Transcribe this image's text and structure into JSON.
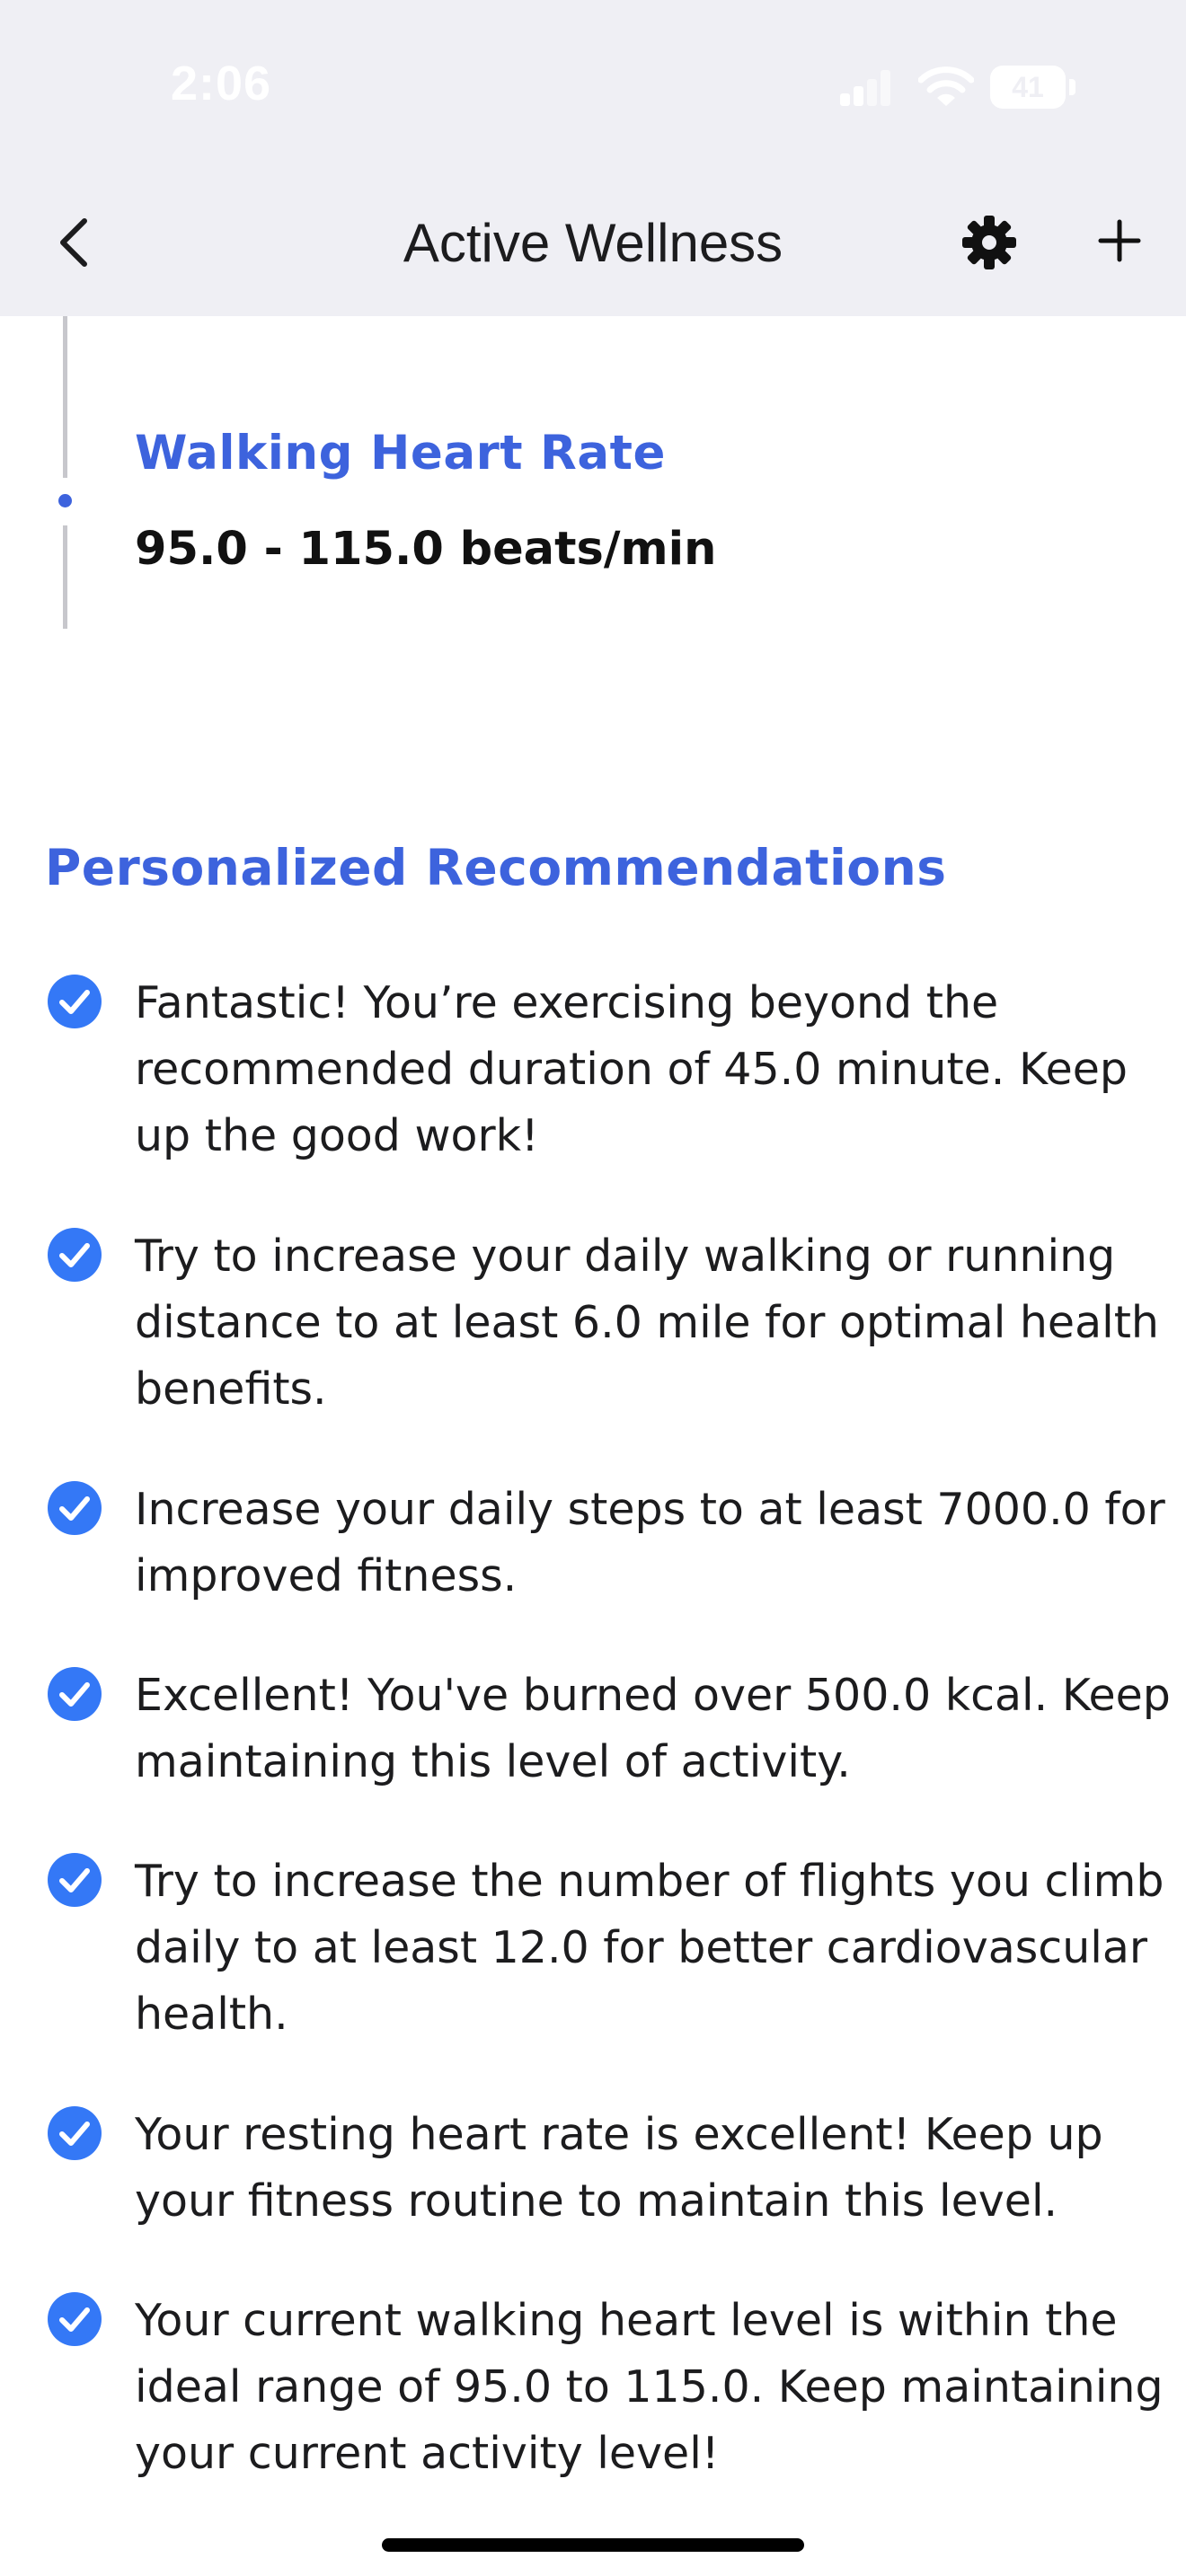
{
  "status_bar": {
    "time": "2:06",
    "battery": "41"
  },
  "header": {
    "title": "Active Wellness"
  },
  "timeline": {
    "metric_title": "Walking Heart Rate",
    "metric_value": "95.0 - 115.0 beats/min"
  },
  "recommendations": {
    "title": "Personalized Recommendations",
    "items": [
      "Fantastic! You’re exercising beyond the recommended duration of 45.0 minute. Keep up the good work!",
      "Try to increase your daily walking or running distance to at least 6.0 mile for optimal health benefits.",
      "Increase your daily steps to at least 7000.0 for improved fitness.",
      "Excellent! You've burned over 500.0 kcal. Keep maintaining this level of activity.",
      "Try to increase the number of flights you climb daily to at least 12.0 for better cardiovascular health.",
      "Your resting heart rate is excellent! Keep up your fitness routine to maintain this level.",
      "Your current walking heart level is within the ideal range of 95.0 to 115.0. Keep maintaining your current activity level!"
    ]
  },
  "colors": {
    "accent": "#3d63dd",
    "check": "#3478f6",
    "header_bg": "#efeff4"
  },
  "icons": {
    "back": "chevron-left-icon",
    "settings": "gear-icon",
    "add": "plus-icon",
    "check": "checkmark-circle-icon"
  }
}
